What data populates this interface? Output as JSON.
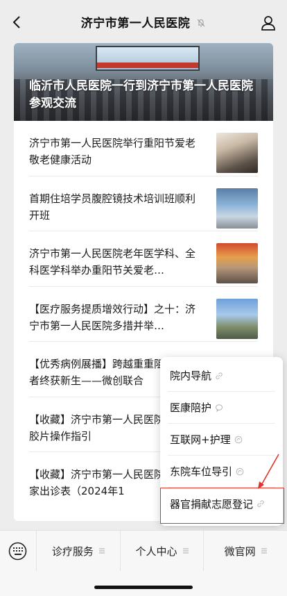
{
  "nav": {
    "title": "济宁市第一人民医院",
    "back_icon": "back-chevron-icon",
    "mute_icon": "bell-muted-icon",
    "profile_icon": "person-icon"
  },
  "hero": {
    "title": "临沂市人民医院一行到济宁市第一人民医院参观交流"
  },
  "articles": [
    {
      "title": "济宁市第一人民医院举行重阳节爱老敬老健康活动"
    },
    {
      "title": "首期住培学员腹腔镜技术培训班顺利开班"
    },
    {
      "title": "济宁市第一人民医院老年医学科、全科医学科举办重阳节关爱老…"
    },
    {
      "title": "【医疗服务提质增效行动】之十：济宁市第一人民医院多措并举…"
    },
    {
      "title": "【优秀病例展播】跨越重重阻碍，患者终获新生——微创联合"
    },
    {
      "title": "【收藏】济宁市第一人民医院数字云胶片操作指引"
    },
    {
      "title": "【收藏】济宁市第一人民医院门诊专家出诊表（2024年1"
    }
  ],
  "popup_menu": {
    "items": [
      {
        "label": "院内导航",
        "icon": "link-icon"
      },
      {
        "label": "医康陪护",
        "icon": "chat-icon"
      },
      {
        "label": "互联网+护理",
        "icon": "mini-program-icon"
      },
      {
        "label": "东院车位导引",
        "icon": "mini-program-icon"
      },
      {
        "label": "器官捐献志愿登记",
        "icon": "link-icon"
      }
    ],
    "highlight_color": "#e0332a"
  },
  "tabbar": {
    "keyboard_icon": "keyboard-icon",
    "tabs": [
      {
        "label": "诊疗服务"
      },
      {
        "label": "个人中心"
      },
      {
        "label": "微官网"
      }
    ]
  }
}
